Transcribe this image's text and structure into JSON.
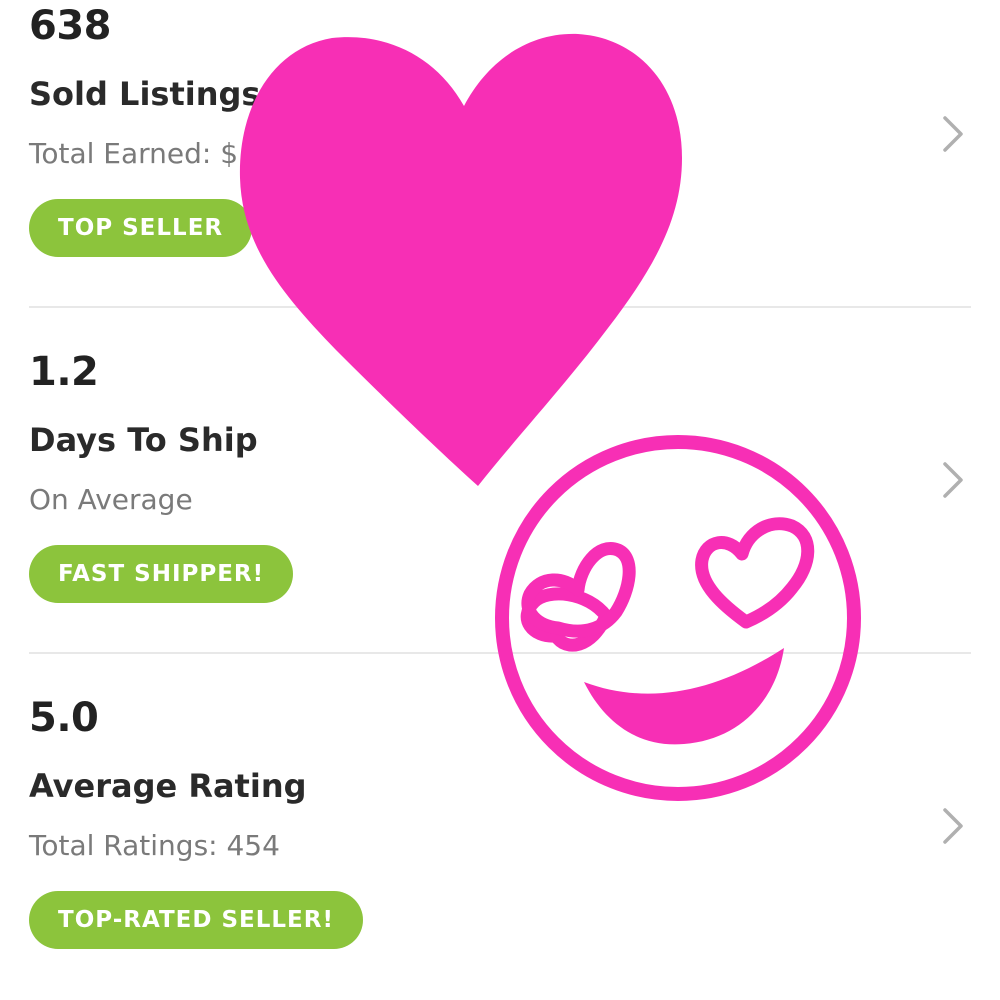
{
  "stats": [
    {
      "value": "638",
      "title": "Sold Listings",
      "subtitle": "Total Earned: $",
      "badge": "TOP SELLER"
    },
    {
      "value": "1.2",
      "title": "Days To Ship",
      "subtitle": "On Average",
      "badge": "FAST SHIPPER!"
    },
    {
      "value": "5.0",
      "title": "Average Rating",
      "subtitle": "Total Ratings: 454",
      "badge": "TOP-RATED SELLER!"
    }
  ],
  "icons": {
    "chevron": "chevron-right-icon",
    "heart_sticker": "heart-icon",
    "smiley_sticker": "heart-eyes-emoji-icon"
  },
  "colors": {
    "badge": "#8cc43c",
    "sticker": "#f72fb5",
    "chevron": "#b0b0b0"
  }
}
